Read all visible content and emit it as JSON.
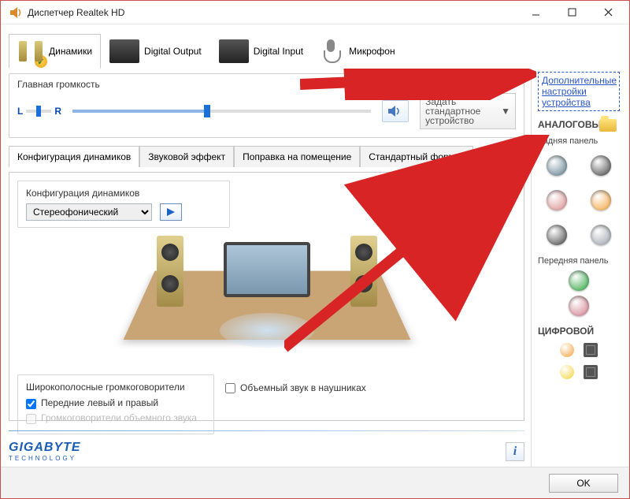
{
  "window": {
    "title": "Диспетчер Realtek HD"
  },
  "deviceTabs": {
    "speakers": "Динамики",
    "digitalOut": "Digital Output",
    "digitalIn": "Digital Input",
    "mic": "Микрофон"
  },
  "advLink": "Дополнительные настройки устройства",
  "mainVolume": {
    "title": "Главная громкость",
    "L": "L",
    "R": "R",
    "balancePos": 50,
    "levelPercent": 44,
    "defaultBtn": "Задать стандартное устройство"
  },
  "configTabs": {
    "speakersCfg": "Конфигурация динамиков",
    "soundFx": "Звуковой эффект",
    "roomCorr": "Поправка на помещение",
    "defaultFmt": "Стандартный формат"
  },
  "speakerConfig": {
    "groupTitle": "Конфигурация динамиков",
    "selected": "Стереофонический"
  },
  "wideband": {
    "groupTitle": "Широкополосные громкоговорители",
    "frontLR": "Передние левый и правый",
    "surround": "Громкоговорители объемного звука",
    "frontChecked": true,
    "surroundChecked": false
  },
  "headphoneSurround": {
    "label": "Объемный звук в наушниках",
    "checked": false
  },
  "rightPanel": {
    "analog": "АНАЛОГОВЫЙ",
    "rearPanel": "Задняя панель",
    "frontPanel": "Передняя панель",
    "digital": "ЦИФРОВОЙ"
  },
  "jacks": {
    "rear": [
      "#5b7a8a",
      "#3f3f3f",
      "#d88a8a",
      "#f2a23a",
      "#3f3f3f",
      "#9aa0a8"
    ],
    "front": [
      "#27a23a",
      "#d07a8a"
    ],
    "digitalCoax": [
      "#f2a23a",
      "#f2d23a"
    ]
  },
  "brand": {
    "name": "GIGABYTE",
    "sub": "TECHNOLOGY"
  },
  "footer": {
    "ok": "OK"
  }
}
